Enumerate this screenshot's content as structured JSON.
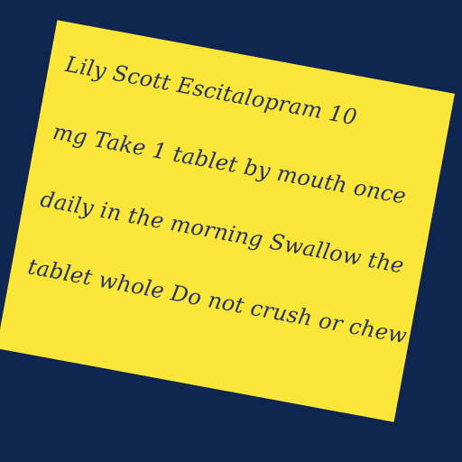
{
  "note": {
    "lines": [
      "Lily Scott Escitalopram 10",
      "mg Take 1 tablet by mouth once",
      "daily in the morning Swallow the",
      "tablet whole Do not crush or chew"
    ],
    "background_color": "#fce63a",
    "text_color": "#24345f"
  },
  "page": {
    "background_color": "#0f2650"
  }
}
